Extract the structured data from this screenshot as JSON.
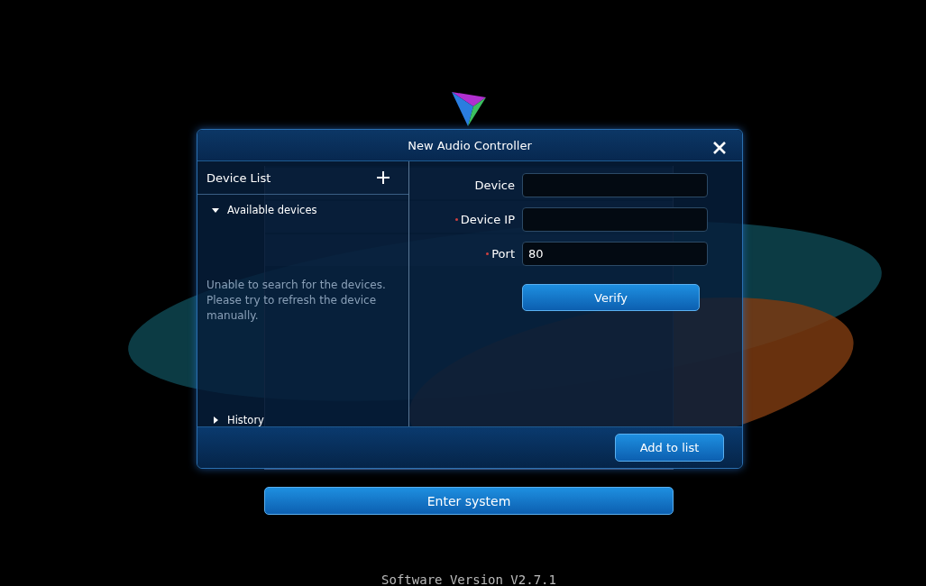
{
  "app": {
    "enter_button": "Enter system",
    "version": "Software Version V2.7.1"
  },
  "dialog": {
    "title": "New Audio Controller",
    "sidebar": {
      "title": "Device List",
      "sections": [
        {
          "label": "Available devices",
          "expanded": true,
          "message": "Unable to search for the devices. Please try to refresh the device manually."
        },
        {
          "label": "History",
          "expanded": false
        }
      ]
    },
    "form": {
      "fields": [
        {
          "label": "Device",
          "required": false
        },
        {
          "label": "Device IP",
          "required": true
        },
        {
          "label": "Port",
          "required": true,
          "value": "80"
        }
      ],
      "verify_button": "Verify"
    },
    "add_button": "Add to list"
  }
}
